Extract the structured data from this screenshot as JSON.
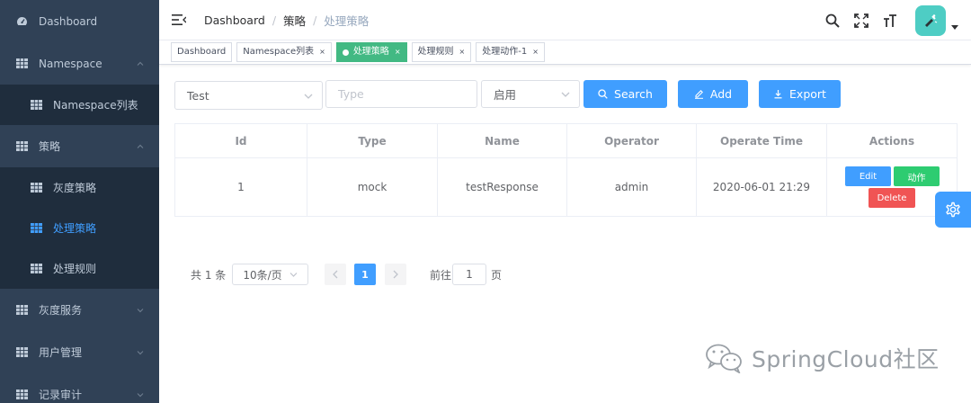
{
  "sidebar": {
    "items": [
      {
        "label": "Dashboard",
        "icon": "dashboard-icon"
      },
      {
        "label": "Namespace",
        "icon": "grid-icon",
        "expanded": true
      },
      {
        "label": "Namespace列表",
        "icon": "grid-icon",
        "sub": true
      },
      {
        "label": "策略",
        "icon": "grid-icon",
        "expanded": true
      },
      {
        "label": "灰度策略",
        "icon": "grid-icon",
        "sub": true
      },
      {
        "label": "处理策略",
        "icon": "grid-icon",
        "sub": true,
        "active": true
      },
      {
        "label": "处理规则",
        "icon": "grid-icon",
        "sub": true
      },
      {
        "label": "灰度服务",
        "icon": "grid-icon"
      },
      {
        "label": "用户管理",
        "icon": "grid-icon"
      },
      {
        "label": "记录审计",
        "icon": "grid-icon"
      }
    ]
  },
  "header": {
    "breadcrumb": [
      "Dashboard",
      "策略",
      "处理策略"
    ],
    "icons": [
      "search-icon",
      "fullscreen-icon",
      "font-size-icon"
    ]
  },
  "tags": [
    {
      "label": "Dashboard",
      "closable": false
    },
    {
      "label": "Namespace列表",
      "closable": true
    },
    {
      "label": "处理策略",
      "closable": true,
      "active": true
    },
    {
      "label": "处理规则",
      "closable": true
    },
    {
      "label": "处理动作-1",
      "closable": true
    }
  ],
  "filters": {
    "select_value": "Test",
    "type_placeholder": "Type",
    "status_value": "启用",
    "search_label": "Search",
    "add_label": "Add",
    "export_label": "Export"
  },
  "table": {
    "columns": [
      "Id",
      "Type",
      "Name",
      "Operator",
      "Operate Time",
      "Actions"
    ],
    "rows": [
      {
        "id": "1",
        "type": "mock",
        "name": "testResponse",
        "operator": "admin",
        "time": "2020-06-01 21:29"
      }
    ],
    "actions": {
      "edit": "Edit",
      "action": "动作",
      "delete": "Delete"
    }
  },
  "pagination": {
    "total": "共 1 条",
    "page_size": "10条/页",
    "current": "1",
    "goto_label": "前往",
    "goto_value": "1",
    "page_suffix": "页"
  },
  "watermark": "SpringCloud社区",
  "colors": {
    "sidebar": "#304156",
    "sidebar_sub": "#1f2d3d",
    "primary": "#409eff",
    "success": "#42b983",
    "action_green": "#2ecc71",
    "danger": "#f05454",
    "avatar": "#4ecdc4"
  }
}
